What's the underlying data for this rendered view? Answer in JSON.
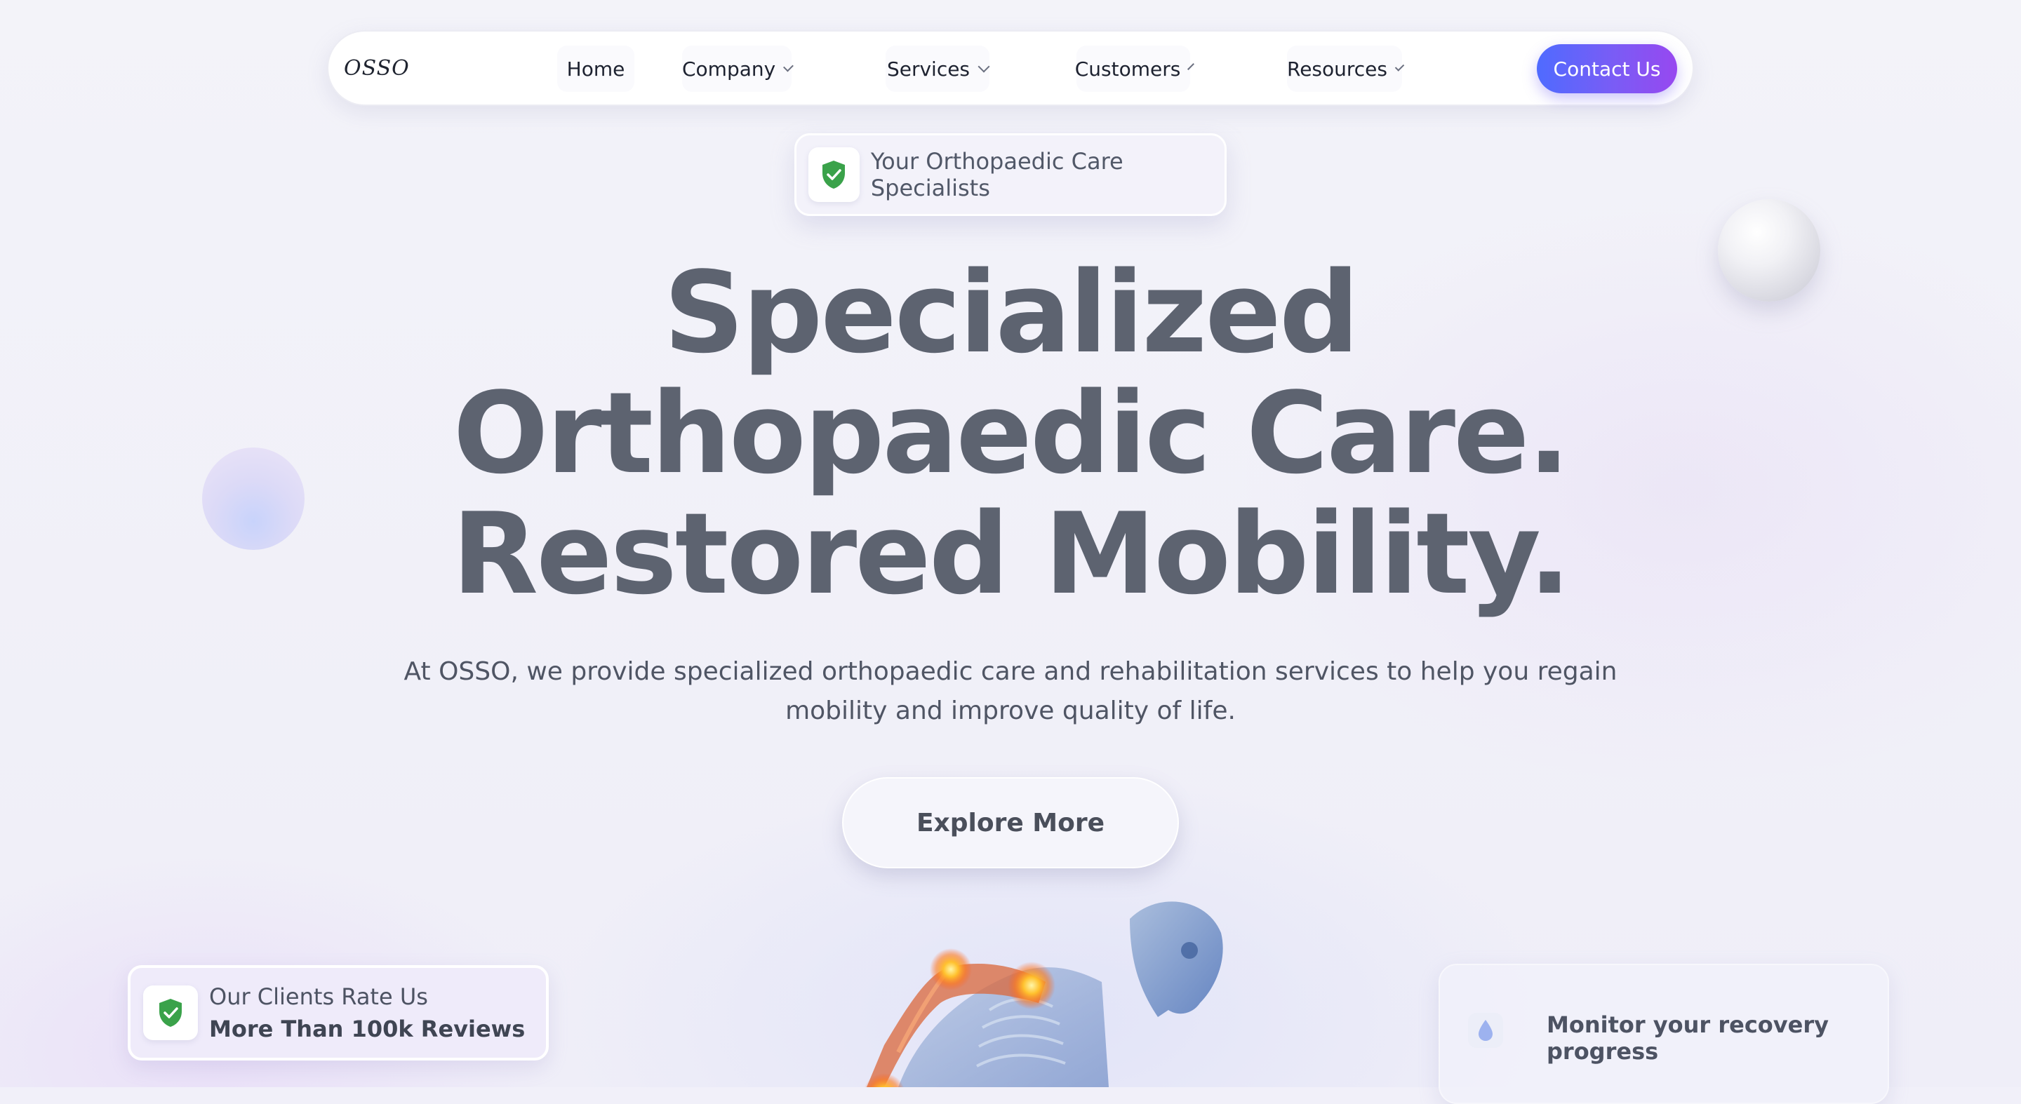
{
  "brand": {
    "logo_text": "OSSO"
  },
  "nav": {
    "items": [
      {
        "label": "Home",
        "has_dropdown": false
      },
      {
        "label": "Company",
        "has_dropdown": true
      },
      {
        "label": "Services",
        "has_dropdown": true
      },
      {
        "label": "Customers",
        "has_dropdown": true
      },
      {
        "label": "Resources",
        "has_dropdown": true
      }
    ],
    "cta_label": "Contact Us"
  },
  "hero": {
    "tag_label": "Your Orthopaedic Care Specialists",
    "headline_lines": [
      "Specialized",
      "Orthopaedic Care.",
      "Restored Mobility."
    ],
    "subtext": "At OSSO, we provide specialized orthopaedic care and rehabilitation services to help you regain mobility and improve quality of life.",
    "cta_label": "Explore More"
  },
  "reviews": {
    "line1": "Our Clients Rate Us",
    "line2": "More Than 100k Reviews"
  },
  "monitor": {
    "label": "Monitor your recovery progress"
  },
  "icons": {
    "shield": "shield-check-icon",
    "drop": "drop-icon",
    "chevron": "chevron-down-icon"
  },
  "colors": {
    "accent_start": "#4f6bff",
    "accent_end": "#9748f0",
    "shield_green": "#3aa24a",
    "headline": "#5d6370",
    "background": "#f1f0f9"
  }
}
